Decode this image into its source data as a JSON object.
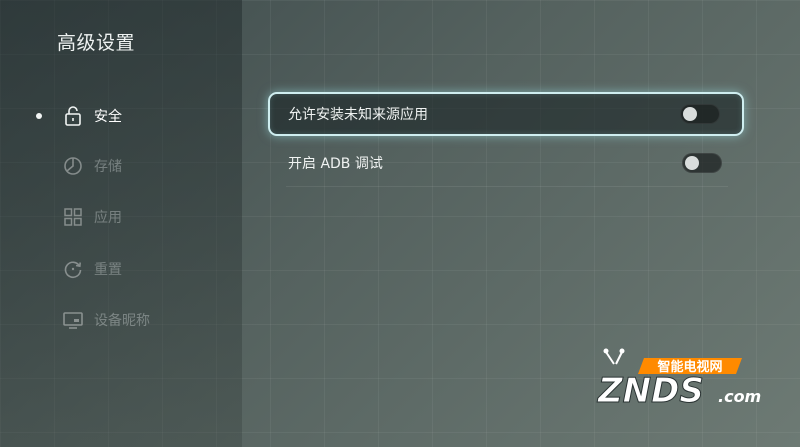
{
  "page": {
    "title": "高级设置"
  },
  "sidebar": {
    "items": [
      {
        "label": "安全",
        "icon": "lock-open-icon",
        "active": true
      },
      {
        "label": "存储",
        "icon": "storage-pie-icon",
        "active": false
      },
      {
        "label": "应用",
        "icon": "apps-grid-icon",
        "active": false
      },
      {
        "label": "重置",
        "icon": "reset-icon",
        "active": false
      },
      {
        "label": "设备昵称",
        "icon": "monitor-icon",
        "active": false
      }
    ]
  },
  "settings": [
    {
      "label": "允许安装未知来源应用",
      "enabled": false
    },
    {
      "label": "开启 ADB 调试",
      "enabled": false
    }
  ],
  "watermark": {
    "text": "智能电视网",
    "brand": "ZNDS",
    "suffix": ".com"
  },
  "colors": {
    "focus_border": "#cfeef0",
    "watermark_orange": "#ff8a00",
    "text": "#e9eeee"
  }
}
